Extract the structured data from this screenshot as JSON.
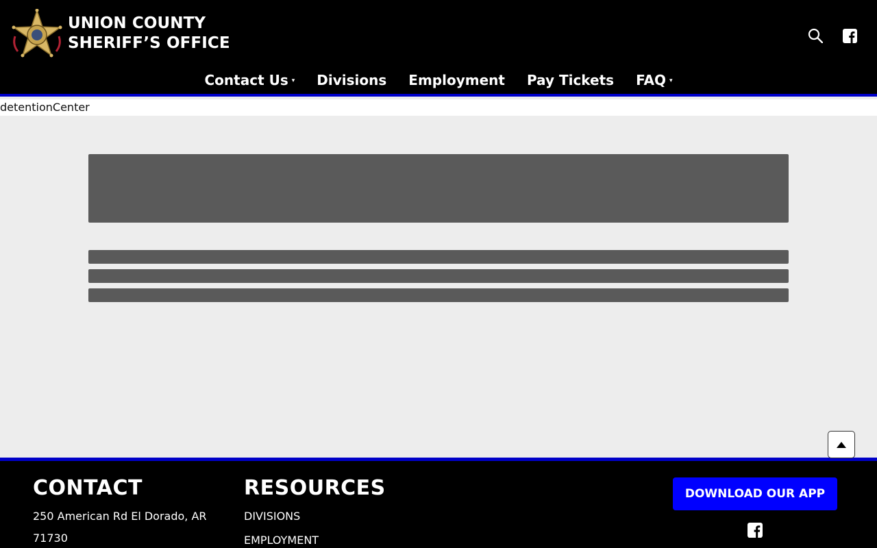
{
  "header": {
    "brand_line1": "UNION COUNTY",
    "brand_line2": "SHERIFF’S OFFICE",
    "logo_icon": "sheriff-star-badge",
    "icons": [
      "search-icon",
      "facebook-icon"
    ]
  },
  "nav": {
    "items": [
      {
        "label": "Contact Us",
        "has_dropdown": true
      },
      {
        "label": "Divisions",
        "has_dropdown": false
      },
      {
        "label": "Employment",
        "has_dropdown": false
      },
      {
        "label": "Pay Tickets",
        "has_dropdown": false
      },
      {
        "label": "FAQ",
        "has_dropdown": true
      }
    ],
    "caret": "▾"
  },
  "breadcrumb": {
    "text": "detentionCenter"
  },
  "footer": {
    "contact_heading": "CONTACT",
    "address_line1": "250 American Rd El Dorado, AR",
    "address_line2": "71730",
    "resources_heading": "RESOURCES",
    "resources_links": [
      "DIVISIONS",
      "EMPLOYMENT"
    ],
    "app_button": "DOWNLOAD OUR APP"
  },
  "colors": {
    "header_bg": "#000000",
    "accent_blue": "#0000c8",
    "app_button_bg": "#0000ff",
    "placeholder_gray": "#5a5a5a",
    "page_bg": "#ededed"
  }
}
